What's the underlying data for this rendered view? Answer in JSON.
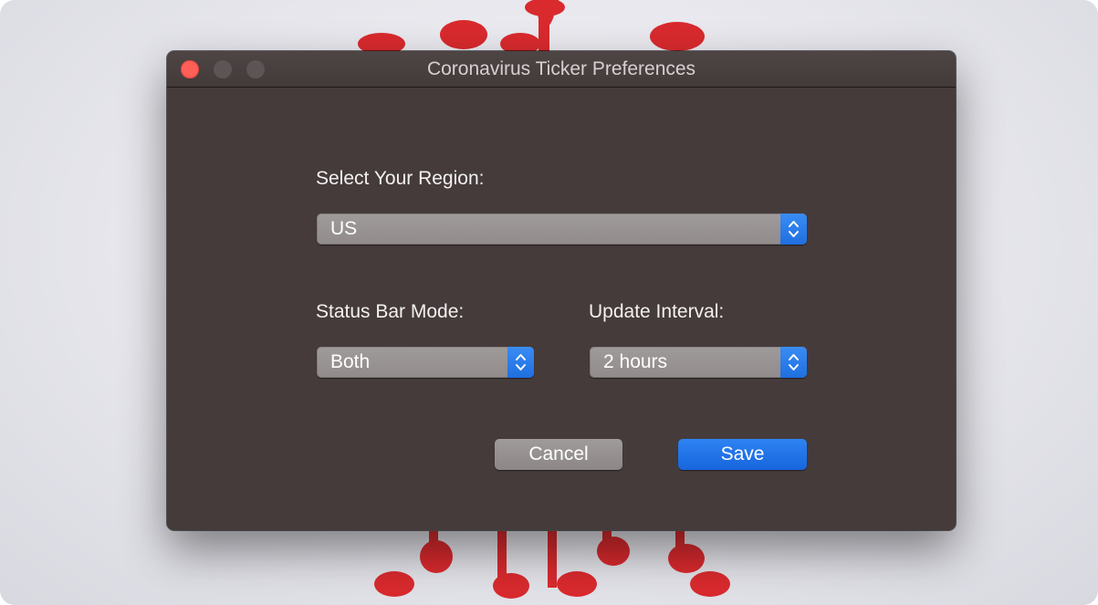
{
  "window": {
    "title": "Coronavirus Ticker Preferences"
  },
  "region": {
    "label": "Select Your Region:",
    "selected": "US"
  },
  "status_bar_mode": {
    "label": "Status Bar Mode:",
    "selected": "Both"
  },
  "update_interval": {
    "label": "Update Interval:",
    "selected": "2 hours"
  },
  "buttons": {
    "cancel_label": "Cancel",
    "save_label": "Save"
  },
  "colors": {
    "window_bg": "#453b3b",
    "accent": "#1f6fe0",
    "close_button": "#fe5f57",
    "backdrop_virus": "#d7262b"
  }
}
